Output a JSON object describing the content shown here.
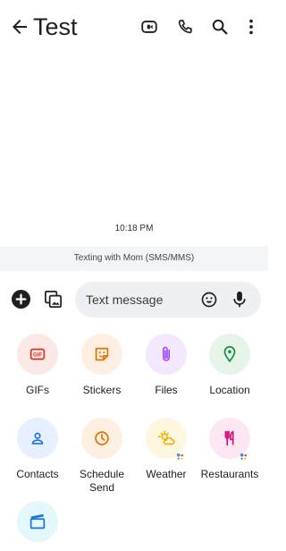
{
  "header": {
    "title": "Test",
    "icons": [
      "back-arrow-icon",
      "video-call-icon",
      "phone-icon",
      "search-icon",
      "more-vert-icon"
    ]
  },
  "conversation": {
    "timestamp": "10:18 PM",
    "info": "Texting with Mom (SMS/MMS)"
  },
  "compose": {
    "placeholder": "Text message",
    "icons": [
      "add-icon",
      "gallery-icon",
      "emoji-icon",
      "mic-icon"
    ]
  },
  "attachments": [
    {
      "label": "GIFs",
      "icon": "gif-icon",
      "color": "#d93025"
    },
    {
      "label": "Stickers",
      "icon": "sticker-icon",
      "color": "#e37400"
    },
    {
      "label": "Files",
      "icon": "paperclip-icon",
      "color": "#a142f4"
    },
    {
      "label": "Location",
      "icon": "location-pin-icon",
      "color": "#1e8e3e"
    },
    {
      "label": "Contacts",
      "icon": "person-icon",
      "color": "#1a73e8"
    },
    {
      "label": "Schedule\nSend",
      "icon": "clock-icon",
      "color": "#e37400"
    },
    {
      "label": "Weather",
      "icon": "weather-icon",
      "color": "#f9ab00"
    },
    {
      "label": "Restaurants",
      "icon": "restaurant-icon",
      "color": "#d01884"
    },
    {
      "label": "",
      "icon": "movie-icon",
      "color": "#1a73e8"
    }
  ],
  "colors": {
    "info_bar_bg": "#f3f5f8",
    "compose_field_bg": "#eef0f4"
  }
}
